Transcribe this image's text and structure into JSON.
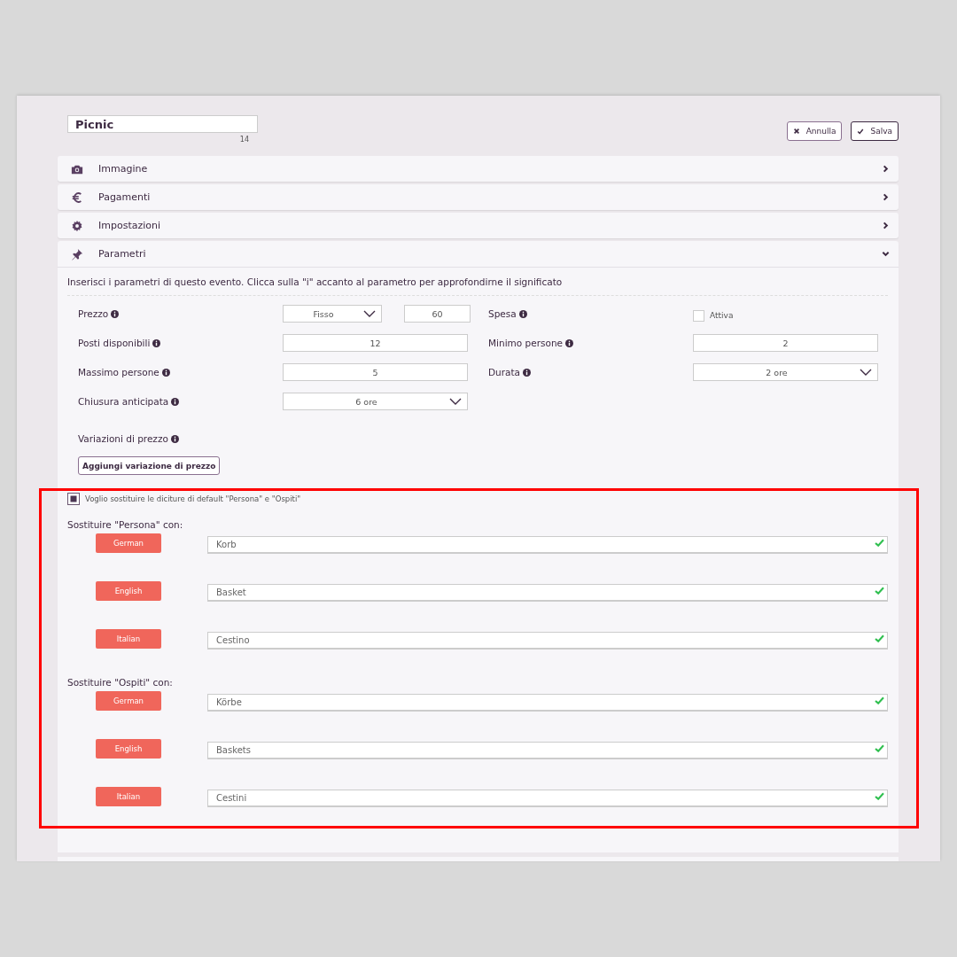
{
  "header": {
    "title_value": "Picnic",
    "char_count": "14",
    "buttons": [
      {
        "kind": "cancel",
        "label": "Annulla"
      },
      {
        "kind": "save",
        "label": "Salva"
      }
    ]
  },
  "sections": [
    {
      "kind": "camera",
      "title": "Immagine",
      "expanded": false
    },
    {
      "kind": "euro",
      "title": "Pagamenti",
      "expanded": false
    },
    {
      "kind": "gear",
      "title": "Impostazioni",
      "expanded": false
    },
    {
      "kind": "pin",
      "title": "Parametri",
      "expanded": true
    }
  ],
  "parameters": {
    "intro": "Inserisci i parametri di questo evento. Clicca sulla \"i\" accanto al parametro per approfondirne il significato",
    "fields": [
      {
        "kind": "select_input",
        "label": "Prezzo",
        "select": "Fisso",
        "value": "60"
      },
      {
        "kind": "checkbox",
        "label": "Spesa",
        "option": "Attiva",
        "checked": false
      },
      {
        "kind": "input",
        "label": "Posti disponibili",
        "value": "12"
      },
      {
        "kind": "input",
        "label": "Minimo persone",
        "value": "2"
      },
      {
        "kind": "input",
        "label": "Massimo persone",
        "value": "5"
      },
      {
        "kind": "select",
        "label": "Durata",
        "value": "2 ore"
      },
      {
        "kind": "select",
        "label": "Chiusura anticipata",
        "value": "6 ore"
      }
    ],
    "variations_label": "Variazioni di prezzo",
    "add_button": "Aggiungi variazione di prezzo"
  },
  "replacement": {
    "checkbox": {
      "label": "Voglio sostituire le diciture di default \"Persona\" e \"Ospiti\"",
      "checked": true
    },
    "groups": [
      {
        "title": "Sostituire \"Persona\" con:",
        "entries": [
          {
            "language": "German",
            "value": "Korb",
            "valid": true
          },
          {
            "language": "English",
            "value": "Basket",
            "valid": true
          },
          {
            "language": "Italian",
            "value": "Cestino",
            "valid": true
          }
        ]
      },
      {
        "title": "Sostituire \"Ospiti\" con:",
        "entries": [
          {
            "language": "German",
            "value": "Körbe",
            "valid": true
          },
          {
            "language": "English",
            "value": "Baskets",
            "valid": true
          },
          {
            "language": "Italian",
            "value": "Cestini",
            "valid": true
          }
        ]
      }
    ]
  }
}
